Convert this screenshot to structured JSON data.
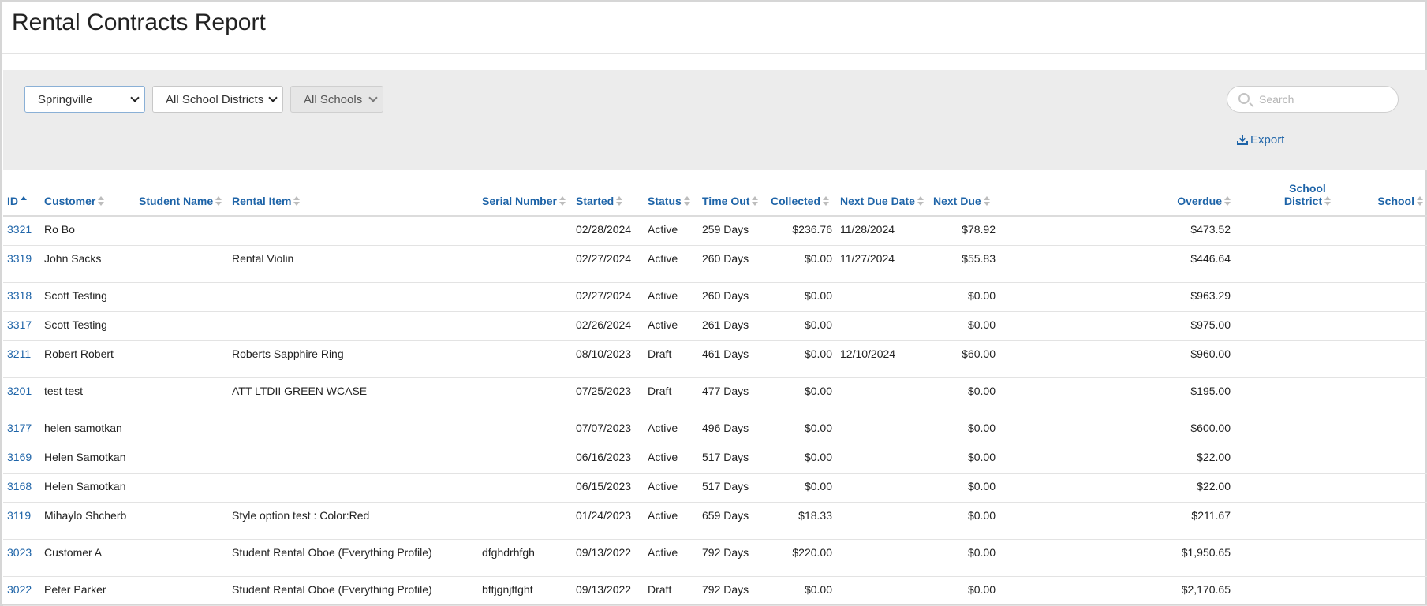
{
  "page": {
    "title": "Rental Contracts Report"
  },
  "filters": {
    "location": {
      "selected": "Springville"
    },
    "district": {
      "selected": "All School Districts"
    },
    "school": {
      "selected": "All Schools"
    }
  },
  "search": {
    "placeholder": "Search"
  },
  "export": {
    "label": "Export"
  },
  "colors": {
    "accent": "#1e64a8",
    "band": "#ececec",
    "border": "#dcdcdc"
  },
  "table": {
    "columns": [
      {
        "key": "id",
        "label": "ID",
        "sort": "asc"
      },
      {
        "key": "customer",
        "label": "Customer"
      },
      {
        "key": "student",
        "label": "Student Name"
      },
      {
        "key": "item",
        "label": "Rental Item"
      },
      {
        "key": "serial",
        "label": "Serial Number"
      },
      {
        "key": "started",
        "label": "Started"
      },
      {
        "key": "status",
        "label": "Status"
      },
      {
        "key": "time_out",
        "label": "Time Out"
      },
      {
        "key": "collected",
        "label": "Collected"
      },
      {
        "key": "next_due_date",
        "label": "Next Due Date"
      },
      {
        "key": "next_due",
        "label": "Next Due"
      },
      {
        "key": "overdue",
        "label": "Overdue"
      },
      {
        "key": "district",
        "label": "School District",
        "label_line1": "School",
        "label_line2": "District"
      },
      {
        "key": "school",
        "label": "School"
      }
    ],
    "rows": [
      {
        "id": "3321",
        "customer": "Ro Bo",
        "student": "",
        "item": "",
        "serial": "",
        "started": "02/28/2024",
        "status": "Active",
        "time_out": "259 Days",
        "collected": "$236.76",
        "next_due_date": "11/28/2024",
        "next_due": "$78.92",
        "overdue": "$473.52",
        "district": "",
        "school": ""
      },
      {
        "id": "3319",
        "customer": "John Sacks",
        "student": "",
        "item": "Rental Violin",
        "serial": "",
        "started": "02/27/2024",
        "status": "Active",
        "time_out": "260 Days",
        "collected": "$0.00",
        "next_due_date": "11/27/2024",
        "next_due": "$55.83",
        "overdue": "$446.64",
        "district": "",
        "school": ""
      },
      {
        "id": "3318",
        "customer": "Scott Testing",
        "student": "",
        "item": "",
        "serial": "",
        "started": "02/27/2024",
        "status": "Active",
        "time_out": "260 Days",
        "collected": "$0.00",
        "next_due_date": "",
        "next_due": "$0.00",
        "overdue": "$963.29",
        "district": "",
        "school": ""
      },
      {
        "id": "3317",
        "customer": "Scott Testing",
        "student": "",
        "item": "",
        "serial": "",
        "started": "02/26/2024",
        "status": "Active",
        "time_out": "261 Days",
        "collected": "$0.00",
        "next_due_date": "",
        "next_due": "$0.00",
        "overdue": "$975.00",
        "district": "",
        "school": ""
      },
      {
        "id": "3211",
        "customer": "Robert Robert",
        "student": "",
        "item": "Roberts Sapphire Ring",
        "serial": "",
        "started": "08/10/2023",
        "status": "Draft",
        "time_out": "461 Days",
        "collected": "$0.00",
        "next_due_date": "12/10/2024",
        "next_due": "$60.00",
        "overdue": "$960.00",
        "district": "",
        "school": ""
      },
      {
        "id": "3201",
        "customer": "test test",
        "student": "",
        "item": "ATT LTDII GREEN WCASE",
        "serial": "",
        "started": "07/25/2023",
        "status": "Draft",
        "time_out": "477 Days",
        "collected": "$0.00",
        "next_due_date": "",
        "next_due": "$0.00",
        "overdue": "$195.00",
        "district": "",
        "school": ""
      },
      {
        "id": "3177",
        "customer": "helen samotkan",
        "student": "",
        "item": "",
        "serial": "",
        "started": "07/07/2023",
        "status": "Active",
        "time_out": "496 Days",
        "collected": "$0.00",
        "next_due_date": "",
        "next_due": "$0.00",
        "overdue": "$600.00",
        "district": "",
        "school": ""
      },
      {
        "id": "3169",
        "customer": "Helen Samotkan",
        "student": "",
        "item": "",
        "serial": "",
        "started": "06/16/2023",
        "status": "Active",
        "time_out": "517 Days",
        "collected": "$0.00",
        "next_due_date": "",
        "next_due": "$0.00",
        "overdue": "$22.00",
        "district": "",
        "school": ""
      },
      {
        "id": "3168",
        "customer": "Helen Samotkan",
        "student": "",
        "item": "",
        "serial": "",
        "started": "06/15/2023",
        "status": "Active",
        "time_out": "517 Days",
        "collected": "$0.00",
        "next_due_date": "",
        "next_due": "$0.00",
        "overdue": "$22.00",
        "district": "",
        "school": ""
      },
      {
        "id": "3119",
        "customer": "Mihaylo Shcherb",
        "student": "",
        "item": "Style option test : Color:Red",
        "serial": "",
        "started": "01/24/2023",
        "status": "Active",
        "time_out": "659 Days",
        "collected": "$18.33",
        "next_due_date": "",
        "next_due": "$0.00",
        "overdue": "$211.67",
        "district": "",
        "school": ""
      },
      {
        "id": "3023",
        "customer": "Customer A",
        "student": "",
        "item": "Student Rental Oboe (Everything Profile)",
        "serial": "dfghdrhfgh",
        "started": "09/13/2022",
        "status": "Active",
        "time_out": "792 Days",
        "collected": "$220.00",
        "next_due_date": "",
        "next_due": "$0.00",
        "overdue": "$1,950.65",
        "district": "",
        "school": ""
      },
      {
        "id": "3022",
        "customer": "Peter Parker",
        "student": "",
        "item": "Student Rental Oboe (Everything Profile)",
        "serial": "bftjgnjftght",
        "started": "09/13/2022",
        "status": "Draft",
        "time_out": "792 Days",
        "collected": "$0.00",
        "next_due_date": "",
        "next_due": "$0.00",
        "overdue": "$2,170.65",
        "district": "",
        "school": ""
      }
    ]
  }
}
